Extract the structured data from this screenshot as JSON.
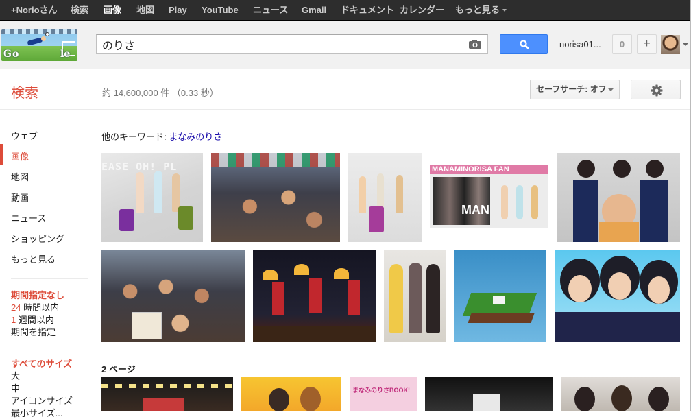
{
  "topbar": {
    "items": [
      {
        "label": "+Norioさん",
        "active": false
      },
      {
        "label": "検索",
        "active": false
      },
      {
        "label": "画像",
        "active": true
      },
      {
        "label": "地図",
        "active": false
      },
      {
        "label": "Play",
        "active": false
      },
      {
        "label": "YouTube",
        "active": false
      },
      {
        "label": "ニュース",
        "active": false
      },
      {
        "label": "Gmail",
        "active": false
      },
      {
        "label": "ドキュメント",
        "active": false
      },
      {
        "label": "カレンダー",
        "active": false
      },
      {
        "label": "もっと見る",
        "active": false,
        "dropdown": true
      }
    ]
  },
  "header": {
    "logo_icon": "soccer-doodle-logo",
    "search_value": "のりさ",
    "search_placeholder": "",
    "camera_icon": "camera-icon",
    "search_icon": "search-icon",
    "user_name": "norisa01...",
    "share_count": "0",
    "share_plus": "+"
  },
  "tools": {
    "title": "検索",
    "result_stats": "約 14,600,000 件 （0.33 秒）",
    "safesearch_label": "セーフサーチ: オフ",
    "settings_icon": "gear-icon"
  },
  "sidebar": {
    "nav": [
      {
        "label": "ウェブ",
        "active": false
      },
      {
        "label": "画像",
        "active": true
      },
      {
        "label": "地図",
        "active": false
      },
      {
        "label": "動画",
        "active": false
      },
      {
        "label": "ニュース",
        "active": false
      },
      {
        "label": "ショッピング",
        "active": false
      },
      {
        "label": "もっと見る",
        "active": false
      }
    ],
    "time_filter": {
      "heading": "期間指定なし",
      "options": [
        {
          "num": "24",
          "text": " 時間以内"
        },
        {
          "num": "1",
          "text": " 週間以内"
        },
        {
          "num": "",
          "text": "期間を指定"
        }
      ]
    },
    "size_filter": {
      "heading": "すべてのサイズ",
      "options": [
        "大",
        "中",
        "アイコンサイズ",
        "最小サイズ..."
      ]
    }
  },
  "results": {
    "related_prefix": "他のキーワード: ",
    "related_link": "まなみのりさ",
    "page_label": "2 ページ",
    "images": [
      {
        "name": "image-girls-suitcases",
        "overlay_text": "EASE OH! PL"
      },
      {
        "name": "image-crowd-fans"
      },
      {
        "name": "image-three-girls-white"
      },
      {
        "name": "image-manaminorisa-fan",
        "overlay_text": "MANAMINORISA FAN"
      },
      {
        "name": "image-girls-with-man"
      },
      {
        "name": "image-crowd-event"
      },
      {
        "name": "image-stage-fans-performance"
      },
      {
        "name": "image-three-girls-standing"
      },
      {
        "name": "image-game-island"
      },
      {
        "name": "image-girls-closeup-blue"
      },
      {
        "name": "image-row3-1"
      },
      {
        "name": "image-row3-2"
      },
      {
        "name": "image-row3-3",
        "overlay_text": "まなみのりさBOOK!"
      },
      {
        "name": "image-row3-4"
      },
      {
        "name": "image-row3-5"
      }
    ]
  }
}
